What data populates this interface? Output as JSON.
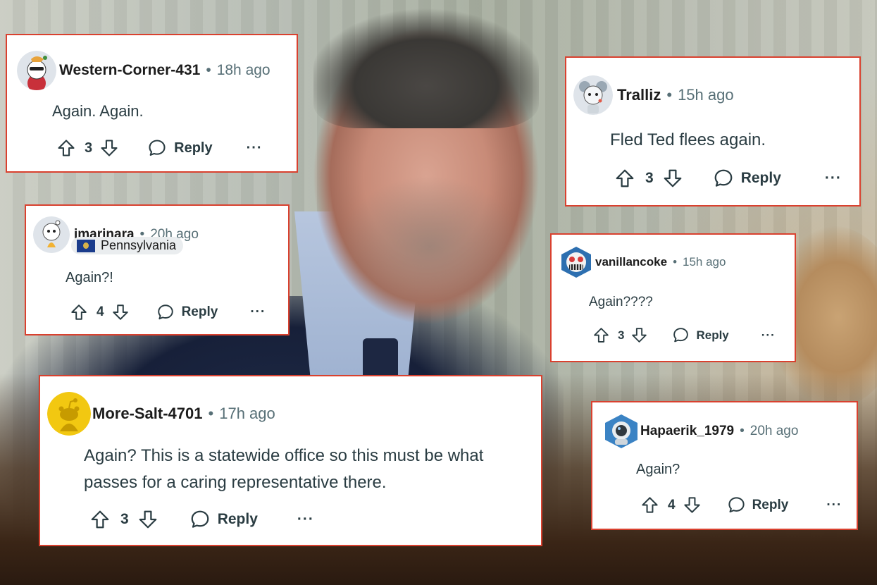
{
  "comments": [
    {
      "username": "Western-Corner-431",
      "separator": "•",
      "time": "18h ago",
      "text": "Again. Again.",
      "votes": "3",
      "reply_label": "Reply",
      "more_label": "···",
      "avatar_icon": "snowman-avatar-icon"
    },
    {
      "username": "Tralliz",
      "separator": "•",
      "time": "15h ago",
      "text": "Fled Ted flees again.",
      "votes": "3",
      "reply_label": "Reply",
      "more_label": "···",
      "avatar_icon": "mouse-ears-avatar-icon"
    },
    {
      "username": "jmarinara",
      "separator": "•",
      "time": "20h ago",
      "flair": "Pennsylvania",
      "text": "Again?!",
      "votes": "4",
      "reply_label": "Reply",
      "more_label": "···",
      "avatar_icon": "snoo-avatar-icon"
    },
    {
      "username": "vanillancoke",
      "separator": "•",
      "time": "15h ago",
      "text": "Again????",
      "votes": "3",
      "reply_label": "Reply",
      "more_label": "···",
      "avatar_icon": "grinning-monster-avatar-icon"
    },
    {
      "username": "More-Salt-4701",
      "separator": "•",
      "time": "17h ago",
      "text": "Again? This is a statewide office so this must be what passes for a caring representative there.",
      "votes": "3",
      "reply_label": "Reply",
      "more_label": "···",
      "avatar_icon": "default-snoo-avatar-icon"
    },
    {
      "username": "Hapaerik_1979",
      "separator": "•",
      "time": "20h ago",
      "text": "Again?",
      "votes": "4",
      "reply_label": "Reply",
      "more_label": "···",
      "avatar_icon": "astronaut-avatar-icon"
    }
  ],
  "colors": {
    "card_border": "#d9412f",
    "meta_text": "#576f76",
    "body_text": "#2a3c42",
    "default_avatar_bg": "#f2c811"
  }
}
